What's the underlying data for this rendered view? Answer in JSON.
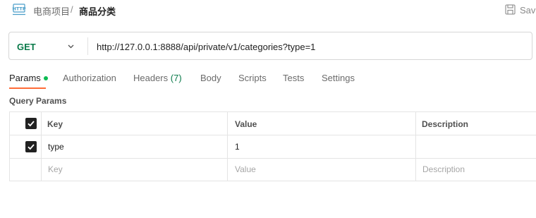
{
  "header": {
    "breadcrumb_parent": "电商项目",
    "breadcrumb_separator": "/",
    "breadcrumb_current": "商品分类",
    "save_label": "Save"
  },
  "request": {
    "method": "GET",
    "url": "http://127.0.0.1:8888/api/private/v1/categories?type=1"
  },
  "tabs": [
    {
      "label": "Params",
      "active": true,
      "indicator": "green-dot"
    },
    {
      "label": "Authorization"
    },
    {
      "label": "Headers",
      "count": "(7)"
    },
    {
      "label": "Body"
    },
    {
      "label": "Scripts"
    },
    {
      "label": "Tests"
    },
    {
      "label": "Settings"
    }
  ],
  "query_params": {
    "title": "Query Params",
    "columns": [
      "Key",
      "Value",
      "Description"
    ],
    "rows": [
      {
        "checked": true,
        "key": "type",
        "value": "1",
        "description": ""
      }
    ],
    "placeholder_row": {
      "key": "Key",
      "value": "Value",
      "description": "Description"
    }
  },
  "colors": {
    "accent_tab_underline": "#ff6c37",
    "method_get": "#0a7a4a",
    "params_dot": "#0cbb52",
    "http_icon": "#4a9ec9"
  },
  "icons": {
    "request_type": "http-icon",
    "save": "floppy-disk-icon",
    "method_dropdown": "chevron-down-icon",
    "checkbox": "checkmark-icon"
  }
}
